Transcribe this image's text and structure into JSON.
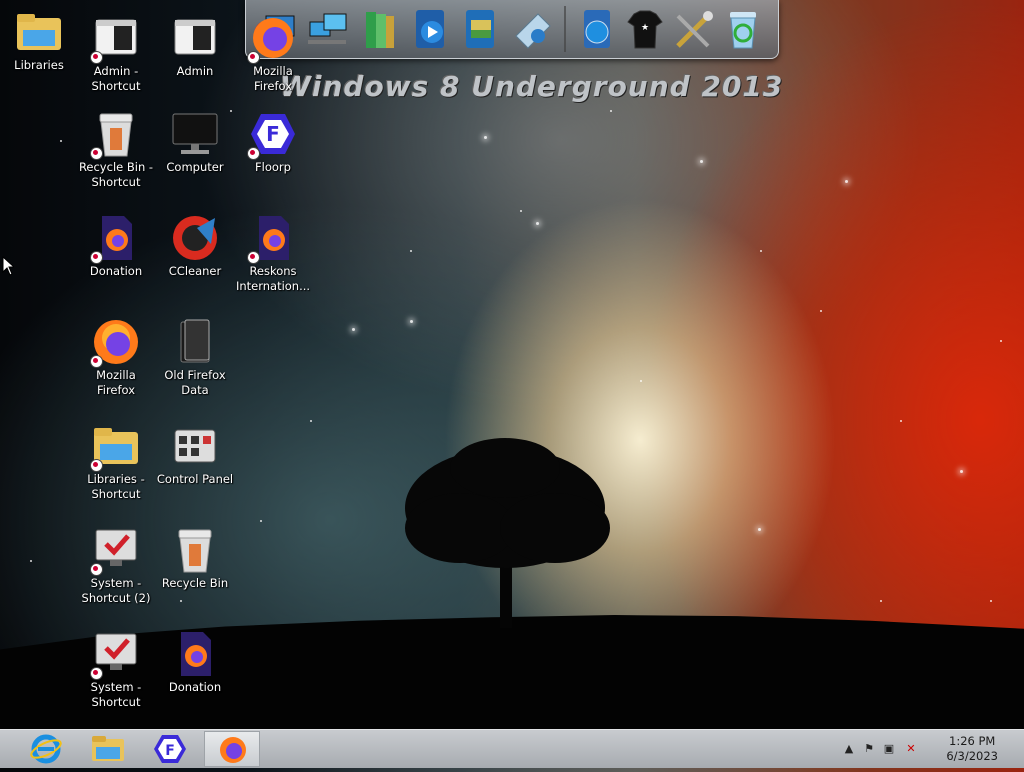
{
  "wallpaper": {
    "watermark": "Windows 8 Underground 2013"
  },
  "desktop_icons": [
    {
      "id": "libraries",
      "label": "Libraries",
      "icon": "folder-libraries-icon"
    },
    {
      "id": "admin-shortcut",
      "label": "Admin -\nShortcut",
      "icon": "admin-user-icon"
    },
    {
      "id": "admin",
      "label": "Admin",
      "icon": "admin-user-icon"
    },
    {
      "id": "mozilla-firefox-top",
      "label": "Mozilla\nFirefox",
      "icon": "firefox-icon"
    },
    {
      "id": "recycle-bin-shortcut",
      "label": "Recycle Bin -\nShortcut",
      "icon": "recycle-bin-icon"
    },
    {
      "id": "computer",
      "label": "Computer",
      "icon": "computer-monitor-icon"
    },
    {
      "id": "floorp",
      "label": "Floorp",
      "icon": "floorp-icon"
    },
    {
      "id": "donation-1",
      "label": "Donation",
      "icon": "firefox-doc-icon"
    },
    {
      "id": "ccleaner",
      "label": "CCleaner",
      "icon": "ccleaner-icon"
    },
    {
      "id": "reskons",
      "label": "Reskons\nInternation...",
      "icon": "firefox-doc-icon"
    },
    {
      "id": "mozilla-firefox",
      "label": "Mozilla\nFirefox",
      "icon": "firefox-icon"
    },
    {
      "id": "old-firefox-data",
      "label": "Old Firefox\nData",
      "icon": "black-folder-icon"
    },
    {
      "id": "libraries-shortcut",
      "label": "Libraries -\nShortcut",
      "icon": "folder-libraries-icon"
    },
    {
      "id": "control-panel",
      "label": "Control Panel",
      "icon": "control-panel-icon"
    },
    {
      "id": "system-shortcut-2",
      "label": "System -\nShortcut (2)",
      "icon": "system-monitor-check-icon"
    },
    {
      "id": "recycle-bin",
      "label": "Recycle Bin",
      "icon": "recycle-bin-icon"
    },
    {
      "id": "system-shortcut",
      "label": "System -\nShortcut",
      "icon": "system-monitor-check-icon"
    },
    {
      "id": "donation-2",
      "label": "Donation",
      "icon": "firefox-doc-icon"
    }
  ],
  "dock": {
    "items": [
      "control-panel-dock-icon",
      "network-icon",
      "library-books-icon",
      "media-player-icon",
      "pictures-icon",
      "drive-icon",
      "help-globe-icon",
      "tshirt-icon",
      "tools-icon",
      "recycle-bin-full-icon"
    ]
  },
  "taskbar": {
    "buttons": [
      "internet-explorer-icon",
      "file-explorer-icon",
      "floorp-icon",
      "firefox-icon"
    ],
    "active_index": 3,
    "tray": {
      "time": "1:26 PM",
      "date": "6/3/2023"
    }
  }
}
